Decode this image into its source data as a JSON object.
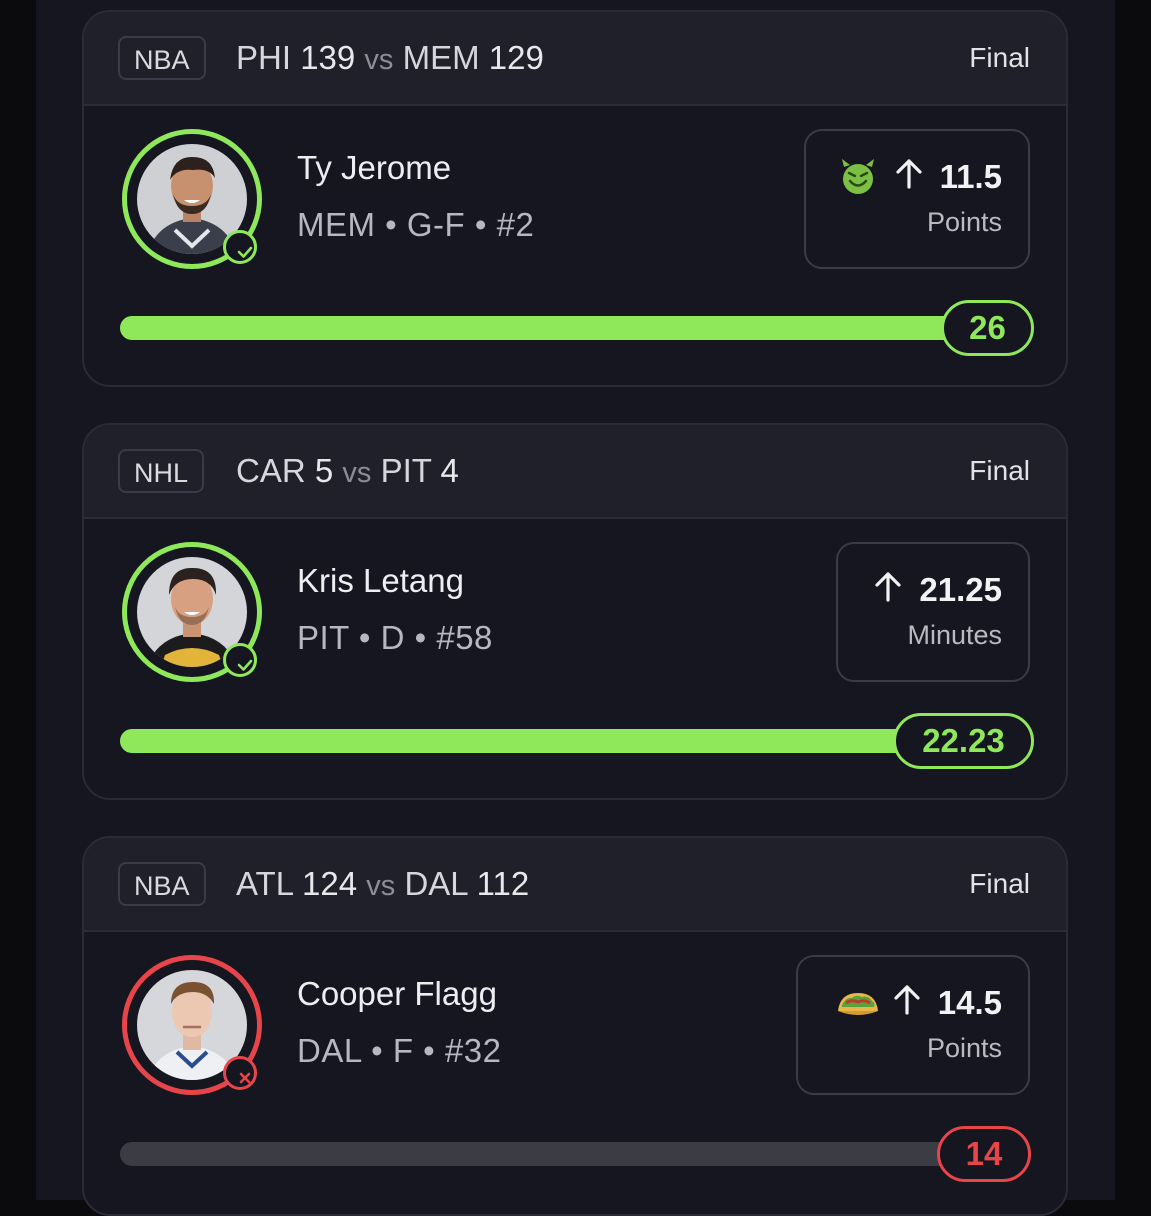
{
  "cards": [
    {
      "league": "NBA",
      "team1": "PHI",
      "score1": "139",
      "vs": "vs",
      "team2": "MEM",
      "score2": "129",
      "status": "Final",
      "player": {
        "name": "Ty Jerome",
        "info": "MEM • G-F • #2"
      },
      "line": {
        "direction_icon": "arrow-up-icon",
        "value": "11.5",
        "stat": "Points",
        "emoji": "smiling-devil-icon"
      },
      "result": {
        "value": "26",
        "outcome": "win",
        "progress": 1.0
      },
      "colors": {
        "accent": "#8fe85a"
      }
    },
    {
      "league": "NHL",
      "team1": "CAR",
      "score1": "5",
      "vs": "vs",
      "team2": "PIT",
      "score2": "4",
      "status": "Final",
      "player": {
        "name": "Kris Letang",
        "info": "PIT • D • #58"
      },
      "line": {
        "direction_icon": "arrow-up-icon",
        "value": "21.25",
        "stat": "Minutes",
        "emoji": ""
      },
      "result": {
        "value": "22.23",
        "outcome": "win",
        "progress": 1.0
      },
      "colors": {
        "accent": "#8fe85a"
      }
    },
    {
      "league": "NBA",
      "team1": "ATL",
      "score1": "124",
      "vs": "vs",
      "team2": "DAL",
      "score2": "112",
      "status": "Final",
      "player": {
        "name": "Cooper Flagg",
        "info": "DAL • F • #32"
      },
      "line": {
        "direction_icon": "arrow-up-icon",
        "value": "14.5",
        "stat": "Points",
        "emoji": "taco-icon"
      },
      "result": {
        "value": "14",
        "outcome": "loss",
        "progress": 0.0
      },
      "colors": {
        "accent": "#e8454b"
      }
    }
  ]
}
